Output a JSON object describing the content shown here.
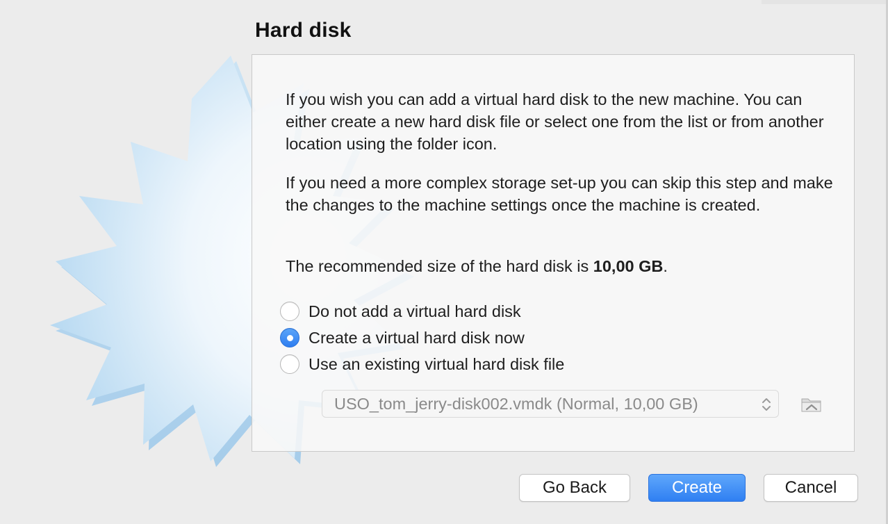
{
  "dialog": {
    "title": "Hard disk"
  },
  "content": {
    "paragraph1": "If you wish you can add a virtual hard disk to the new machine. You can either create a new hard disk file or select one from the list or from another location using the folder icon.",
    "paragraph2": "If you need a more complex storage set-up you can skip this step and make the changes to the machine settings once the machine is created.",
    "recommended_prefix": "The recommended size of the hard disk is ",
    "recommended_size": "10,00 GB",
    "recommended_suffix": "."
  },
  "options": {
    "no_disk": "Do not add a virtual hard disk",
    "create_now": "Create a virtual hard disk now",
    "use_existing": "Use an existing virtual hard disk file",
    "selected": "create_now"
  },
  "disk_select": {
    "value": "USO_tom_jerry-disk002.vmdk (Normal, 10,00 GB)"
  },
  "buttons": {
    "back": "Go Back",
    "create": "Create",
    "cancel": "Cancel"
  },
  "icons": {
    "star": "starburst-wizard-icon",
    "folder": "folder-icon",
    "select_arrows": "up-down-arrows-icon"
  },
  "colors": {
    "accent": "#2f7ff2",
    "background": "#ececec"
  }
}
